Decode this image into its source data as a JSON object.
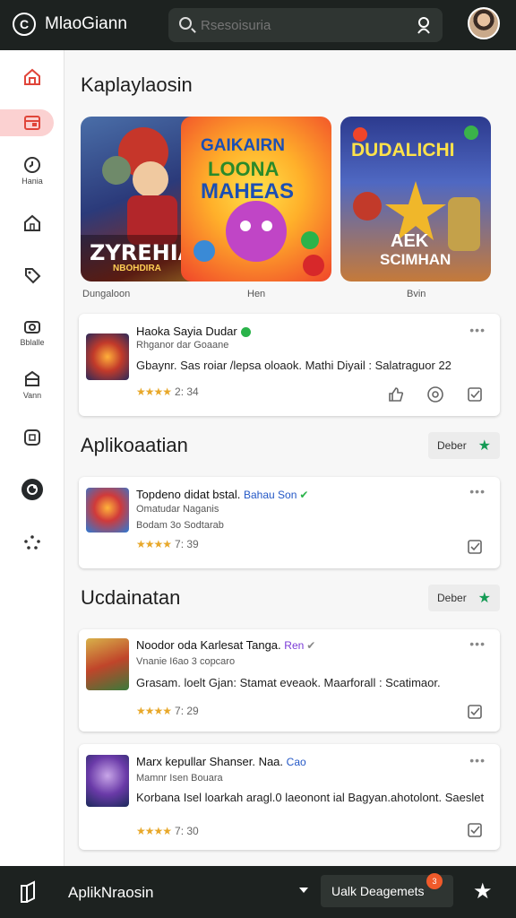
{
  "header": {
    "title": "MlaoGiann",
    "logo_letter": "C",
    "search_placeholder": "Rsesoisuria"
  },
  "sidebar": {
    "items": [
      {
        "icon": "home-icon",
        "label": ""
      },
      {
        "icon": "library-icon",
        "label": ""
      },
      {
        "icon": "clock-icon",
        "label": "Hania"
      },
      {
        "icon": "house-icon",
        "label": ""
      },
      {
        "icon": "tag-icon",
        "label": ""
      },
      {
        "icon": "camera-icon",
        "label": "Bblalle"
      },
      {
        "icon": "archive-icon",
        "label": "Vann"
      },
      {
        "icon": "tablet-icon",
        "label": ""
      },
      {
        "icon": "record-icon",
        "label": ""
      },
      {
        "icon": "share-icon",
        "label": ""
      }
    ]
  },
  "featured": {
    "heading": "Kaplaylaosin",
    "tiles": [
      {
        "art_text_1": "ZYREHIA",
        "art_text_2": "NBOHDIRA",
        "caption": "Dungaloon"
      },
      {
        "art_text_1": "GAIKAIRN",
        "art_text_2": "LOONA",
        "art_text_3": "MAHEAS",
        "caption": "Hen"
      },
      {
        "art_text_1": "DUDALICHI",
        "art_text_2": "AEK",
        "art_text_3": "SCIMHAN",
        "caption": "Bvin"
      }
    ]
  },
  "top_card": {
    "title": "Haoka Sayia Dudar",
    "subtitle": "Rhganor dar Goaane",
    "description": "Gbaynr. Sas roiar /lepsa oloaok.  Mathi Diyail : Salatraguor 22",
    "stars": "★★★★",
    "rating": "2: 34"
  },
  "section_apps": {
    "heading": "Aplikoaatian",
    "more_label": "Deber",
    "card": {
      "title": "Topdeno didat bstal.",
      "tag": "Bahau Son",
      "subtitle": "Omatudar Naganis",
      "detail": "Bodam 3o Sodtarab",
      "stars": "★★★★",
      "rating": "7: 39"
    }
  },
  "section_updates": {
    "heading": "Ucdainatan",
    "more_label": "Deber",
    "cards": [
      {
        "title": "Noodor oda Karlesat Tanga.",
        "tag": "Ren",
        "subtitle": "Vnanie I6ao 3 copcaro",
        "description": "Grasam. loelt Gjan: Stamat eveaok.  Maarforall : Scatimaor.",
        "stars": "★★★★",
        "rating": "7: 29"
      },
      {
        "title": "Marx kepullar Shanser. Naa.",
        "tag": "Cao",
        "subtitle": "Mamnr Isen Bouara",
        "description": "Korbana Isel loarkah aragl.0 laeonont ial Bagyan.ahotolont. Saeslet",
        "stars": "★★★★",
        "rating": "7: 30"
      }
    ]
  },
  "bottombar": {
    "label": "AplikNraosin",
    "upload_label": "Ualk Deagemets",
    "badge": "3"
  },
  "colors": {
    "topbar_bg": "#1d2220",
    "active_nav": "#fbd1d1",
    "star": "#e8a82a",
    "verified": "#2ab34a",
    "accent_green": "#159b55",
    "badge": "#f05a2a"
  }
}
